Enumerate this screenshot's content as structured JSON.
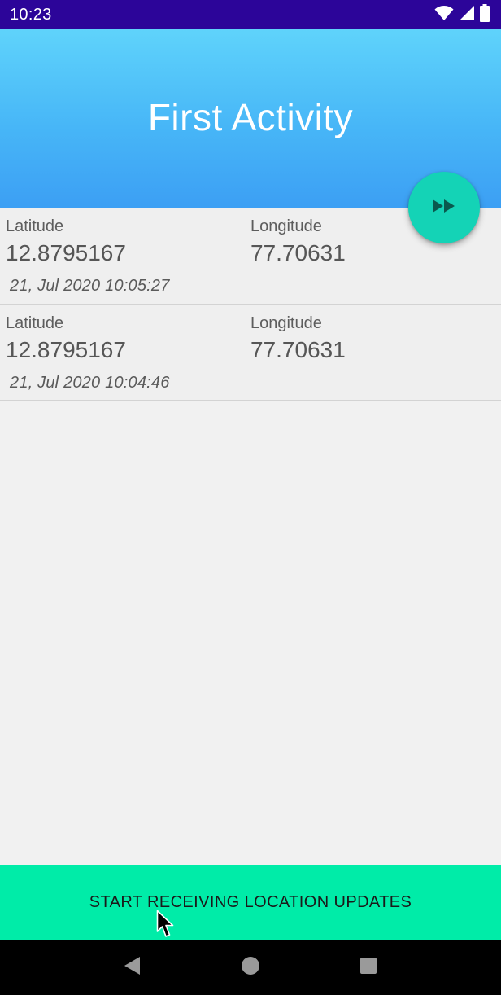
{
  "status_bar": {
    "time": "10:23",
    "icons": [
      "wifi-icon",
      "signal-icon",
      "battery-icon"
    ]
  },
  "header": {
    "title": "First Activity"
  },
  "fab": {
    "icon": "fast-forward-icon"
  },
  "locations": [
    {
      "latitude_label": "Latitude",
      "latitude": "12.8795167",
      "longitude_label": "Longitude",
      "longitude": "77.70631",
      "timestamp": "21, Jul 2020 10:05:27"
    },
    {
      "latitude_label": "Latitude",
      "latitude": "12.8795167",
      "longitude_label": "Longitude",
      "longitude": "77.70631",
      "timestamp": "21, Jul 2020 10:04:46"
    }
  ],
  "action": {
    "label": "START RECEIVING LOCATION UPDATES"
  },
  "nav_bar": {
    "items": [
      "back-icon",
      "home-icon",
      "recents-icon"
    ]
  },
  "colors": {
    "status_bar": "#2c0599",
    "header_top": "#5fd3fb",
    "header_bottom": "#3c9ff4",
    "fab": "#14d3b6",
    "action_button": "#00eca8"
  }
}
